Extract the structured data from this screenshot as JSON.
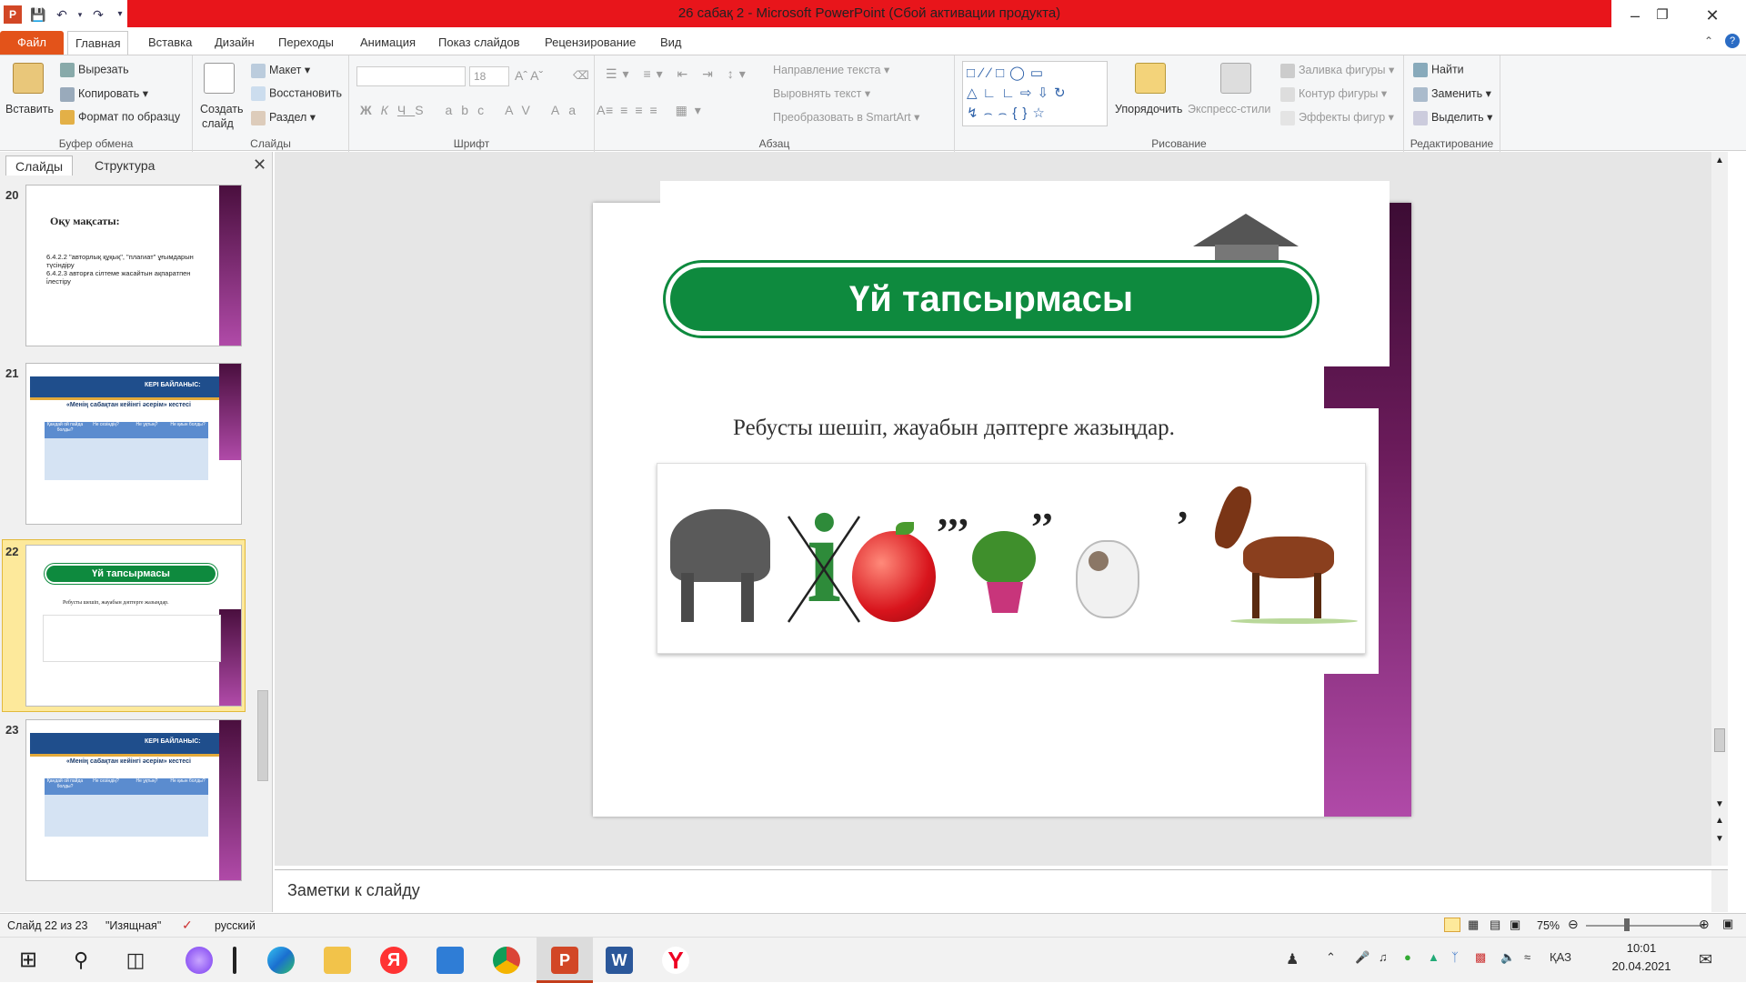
{
  "window": {
    "title": "26 сабақ 2  -  Microsoft PowerPoint (Сбой активации продукта)"
  },
  "tabs": [
    {
      "label": "Файл"
    },
    {
      "label": "Главная"
    },
    {
      "label": "Вставка"
    },
    {
      "label": "Дизайн"
    },
    {
      "label": "Переходы"
    },
    {
      "label": "Анимация"
    },
    {
      "label": "Показ слайдов"
    },
    {
      "label": "Рецензирование"
    },
    {
      "label": "Вид"
    }
  ],
  "ribbon": {
    "clipboard": {
      "label": "Буфер обмена",
      "paste": "Вставить",
      "cut": "Вырезать",
      "copy": "Копировать",
      "format_painter": "Формат по образцу"
    },
    "slides": {
      "label": "Слайды",
      "new_slide_1": "Создать",
      "new_slide_2": "слайд",
      "layout": "Макет",
      "reset": "Восстановить",
      "section": "Раздел"
    },
    "font": {
      "label": "Шрифт",
      "font_size": "18"
    },
    "paragraph": {
      "label": "Абзац",
      "text_direction": "Направление текста",
      "align_text": "Выровнять текст",
      "smartart": "Преобразовать в SmartArt"
    },
    "drawing": {
      "label": "Рисование",
      "arrange_1": "Упорядочить",
      "quick_styles": "Экспресс-стили",
      "shape_fill": "Заливка фигуры",
      "shape_outline": "Контур фигуры",
      "shape_effects": "Эффекты фигур"
    },
    "editing": {
      "label": "Редактирование",
      "find": "Найти",
      "replace": "Заменить",
      "select": "Выделить"
    }
  },
  "pane": {
    "tab_slides": "Слайды",
    "tab_outline": "Структура",
    "thumbnails": [
      {
        "num": "20",
        "title": "Оқу мақсаты:",
        "line1": "6.4.2.2 \"авторлық құқық\", \"плагиат\" ұғымдарын түсіндіру",
        "line2": "6.4.2.3 авторға сілтеме жасайтын ақпаратпен і́лестіру"
      },
      {
        "num": "21",
        "header": "КЕРІ БАЙЛАНЫС:",
        "subtitle": "«Менің сабақтан кейінгі әсерім» кестесі",
        "cols": [
          "Қандай ой пайда болды?",
          "Не сезіндің?",
          "Не ұқтың?",
          "Не қиын болды?"
        ]
      },
      {
        "num": "22",
        "title": "Үй тапсырмасы",
        "caption": "Ребусты шешіп, жауабын дәптерге жазыңдар."
      },
      {
        "num": "23",
        "header": "КЕРІ БАЙЛАНЫС:",
        "subtitle": "«Менің сабақтан кейінгі әсерім» кестесі",
        "cols": [
          "Қандай ой пайда болды?",
          "Не сезіндің?",
          "Не ұқтың?",
          "Не қиын болды?"
        ]
      }
    ]
  },
  "slide": {
    "title": "Үй тапсырмасы",
    "caption": "Ребусты шешіп, жауабын дәптерге жазыңдар.",
    "rebus_letter": "і",
    "quotes_1": "’’’",
    "quotes_2": "’’",
    "quotes_3": "’"
  },
  "notes": {
    "placeholder": "Заметки к слайду"
  },
  "status": {
    "slide_of": "Слайд 22 из 23",
    "theme": "\"Изящная\"",
    "language": "русский",
    "zoom": "75%"
  },
  "taskbar": {
    "lang": "ҚАЗ",
    "time": "10:01",
    "date": "20.04.2021"
  },
  "colors": {
    "title_red": "#e8151b",
    "file_tab": "#e3531a",
    "banner_green": "#0e8a3e",
    "slide_purple": "#9c3a8c"
  }
}
